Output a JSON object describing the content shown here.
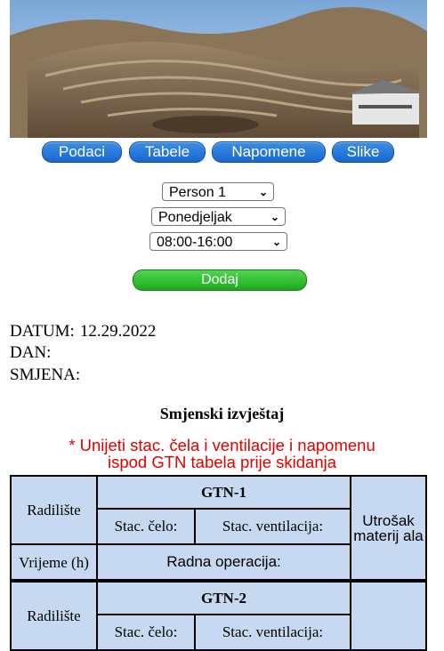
{
  "nav": {
    "buttons": [
      "Podaci",
      "Tabele",
      "Napomene",
      "Slike"
    ]
  },
  "form": {
    "person": "Person 1",
    "day": "Ponedjeljak",
    "shift": "08:00-16:00",
    "add_label": "Dodaj"
  },
  "info": {
    "datum_label": "DATUM:",
    "datum_value": "12.29.2022",
    "dan_label": "DAN:",
    "smjena_label": "SMJENA:"
  },
  "report": {
    "title": "Smjenski izvještaj",
    "warning_line1": "* Unijeti stac. čela i ventilacije i napomenu",
    "warning_line2": "ispod GTN tabela prije skidanja",
    "tables": [
      {
        "name": "GTN-1",
        "radiliste": "Radilište",
        "stac_celo": "Stac. čelo:",
        "stac_ventilacija": "Stac. ventilacija:",
        "utrosak": "Utrošak materij ala",
        "vrijeme": "Vrijeme (h)",
        "radna_operacija": "Radna operacija:"
      },
      {
        "name": "GTN-2",
        "radiliste": "Radilište",
        "stac_celo": "Stac. čelo:",
        "stac_ventilacija": "Stac. ventilacija:"
      }
    ]
  },
  "colors": {
    "nav_button": "#1a66cc",
    "add_button": "#1fa81f",
    "table_fill": "#c6d9f1",
    "warning": "#e00000"
  }
}
